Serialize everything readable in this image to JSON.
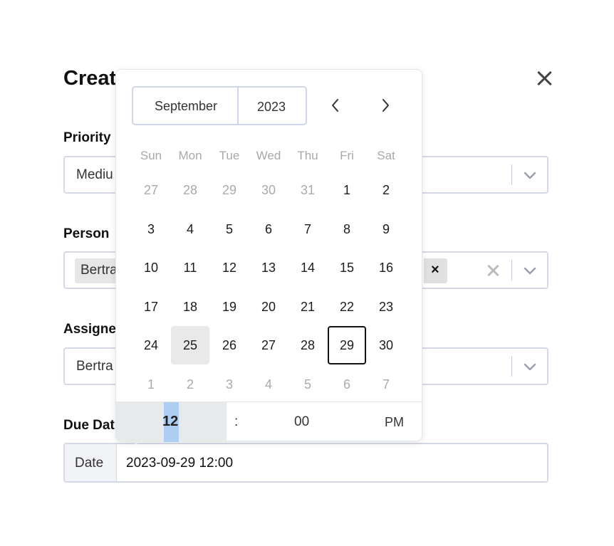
{
  "dialog": {
    "title": "Creat",
    "fields": {
      "priority": {
        "label": "Priority",
        "value": "Mediu"
      },
      "person": {
        "label": "Person",
        "tag": "Bertra",
        "tag_remove": "×"
      },
      "assignee": {
        "label": "Assigne",
        "value": "Bertra"
      },
      "due_date": {
        "label": "Due Dat",
        "prefix": "Date",
        "value": "2023-09-29 12:00"
      }
    }
  },
  "calendar": {
    "month": "September",
    "year": "2023",
    "weekdays": [
      "Sun",
      "Mon",
      "Tue",
      "Wed",
      "Thu",
      "Fri",
      "Sat"
    ],
    "weeks": [
      [
        "27",
        "28",
        "29",
        "30",
        "31",
        "1",
        "2"
      ],
      [
        "3",
        "4",
        "5",
        "6",
        "7",
        "8",
        "9"
      ],
      [
        "10",
        "11",
        "12",
        "13",
        "14",
        "15",
        "16"
      ],
      [
        "17",
        "18",
        "19",
        "20",
        "21",
        "22",
        "23"
      ],
      [
        "24",
        "25",
        "26",
        "27",
        "28",
        "29",
        "30"
      ],
      [
        "1",
        "2",
        "3",
        "4",
        "5",
        "6",
        "7"
      ]
    ],
    "outside_month": [
      [
        0,
        0
      ],
      [
        0,
        1
      ],
      [
        0,
        2
      ],
      [
        0,
        3
      ],
      [
        0,
        4
      ],
      [
        5,
        0
      ],
      [
        5,
        1
      ],
      [
        5,
        2
      ],
      [
        5,
        3
      ],
      [
        5,
        4
      ],
      [
        5,
        5
      ],
      [
        5,
        6
      ]
    ],
    "today": [
      4,
      1
    ],
    "selected": [
      4,
      5
    ],
    "time": {
      "hour": "12",
      "separator": ":",
      "minute": "00",
      "meridiem": "PM"
    }
  }
}
